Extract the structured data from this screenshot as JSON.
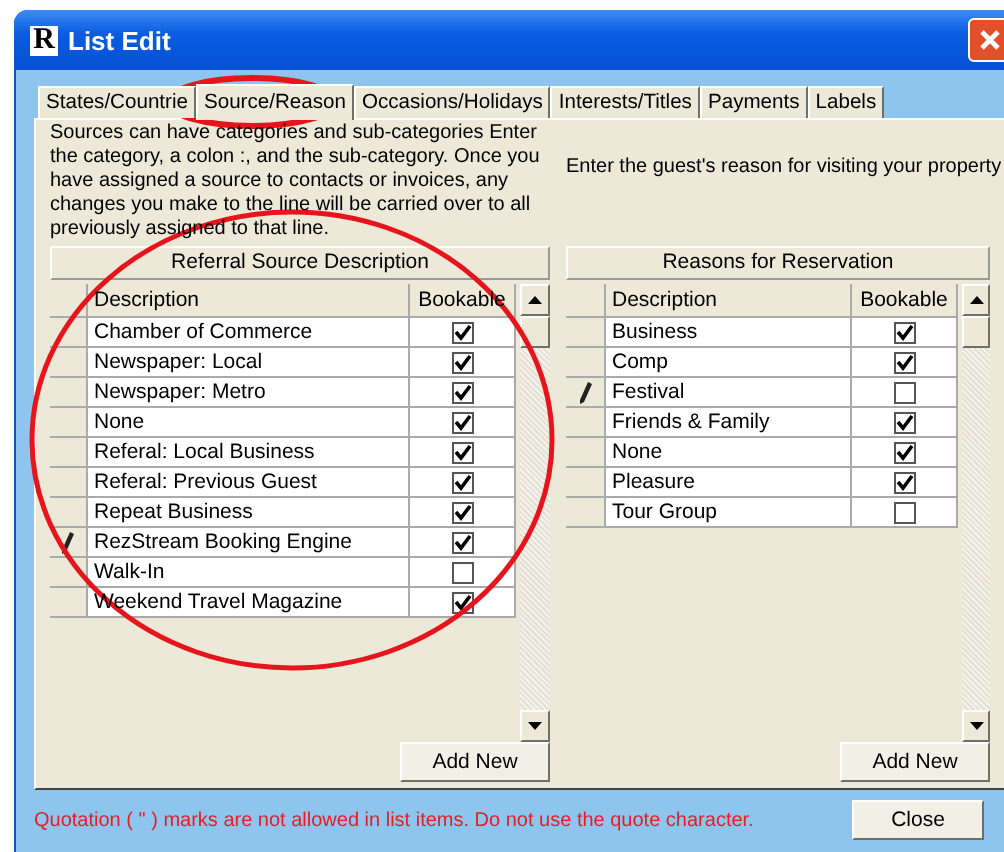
{
  "window": {
    "icon_letter": "R",
    "title": "List Edit"
  },
  "tabs": [
    {
      "label": "States/Countrie",
      "selected": false
    },
    {
      "label": "Source/Reason",
      "selected": true
    },
    {
      "label": "Occasions/Holidays",
      "selected": false
    },
    {
      "label": "Interests/Titles",
      "selected": false
    },
    {
      "label": "Payments",
      "selected": false
    },
    {
      "label": "Labels",
      "selected": false
    }
  ],
  "panels": [
    {
      "info": "Sources can have categories and sub-categories Enter the category, a colon :, and the sub-category. Once you have assigned a source to contacts or invoices, any changes you make to the line will be carried over to all previously assigned to that line.",
      "grid_title": "Referral Source Description",
      "columns": [
        "Description",
        "Bookable"
      ],
      "button": "Add New",
      "rows": [
        {
          "description": "Chamber of Commerce",
          "bookable": true,
          "editing": false
        },
        {
          "description": "Newspaper: Local",
          "bookable": true,
          "editing": false
        },
        {
          "description": "Newspaper: Metro",
          "bookable": true,
          "editing": false
        },
        {
          "description": "None",
          "bookable": true,
          "editing": false
        },
        {
          "description": "Referal: Local Business",
          "bookable": true,
          "editing": false
        },
        {
          "description": "Referal: Previous Guest",
          "bookable": true,
          "editing": false
        },
        {
          "description": "Repeat Business",
          "bookable": true,
          "editing": false
        },
        {
          "description": "RezStream Booking Engine",
          "bookable": true,
          "editing": true
        },
        {
          "description": "Walk-In",
          "bookable": false,
          "editing": false
        },
        {
          "description": "Weekend Travel Magazine",
          "bookable": true,
          "editing": false
        }
      ]
    },
    {
      "info": "Enter the guest's reason for visiting your property",
      "grid_title": "Reasons for Reservation",
      "columns": [
        "Description",
        "Bookable"
      ],
      "button": "Add New",
      "rows": [
        {
          "description": "Business",
          "bookable": true,
          "editing": false
        },
        {
          "description": "Comp",
          "bookable": true,
          "editing": false
        },
        {
          "description": "Festival",
          "bookable": false,
          "editing": true
        },
        {
          "description": "Friends & Family",
          "bookable": true,
          "editing": false
        },
        {
          "description": "None",
          "bookable": true,
          "editing": false
        },
        {
          "description": "Pleasure",
          "bookable": true,
          "editing": false
        },
        {
          "description": "Tour Group",
          "bookable": false,
          "editing": false
        }
      ]
    }
  ],
  "warning": "Quotation ( \" ) marks are not allowed in list items. Do not use the quote character.",
  "close_button": "Close"
}
